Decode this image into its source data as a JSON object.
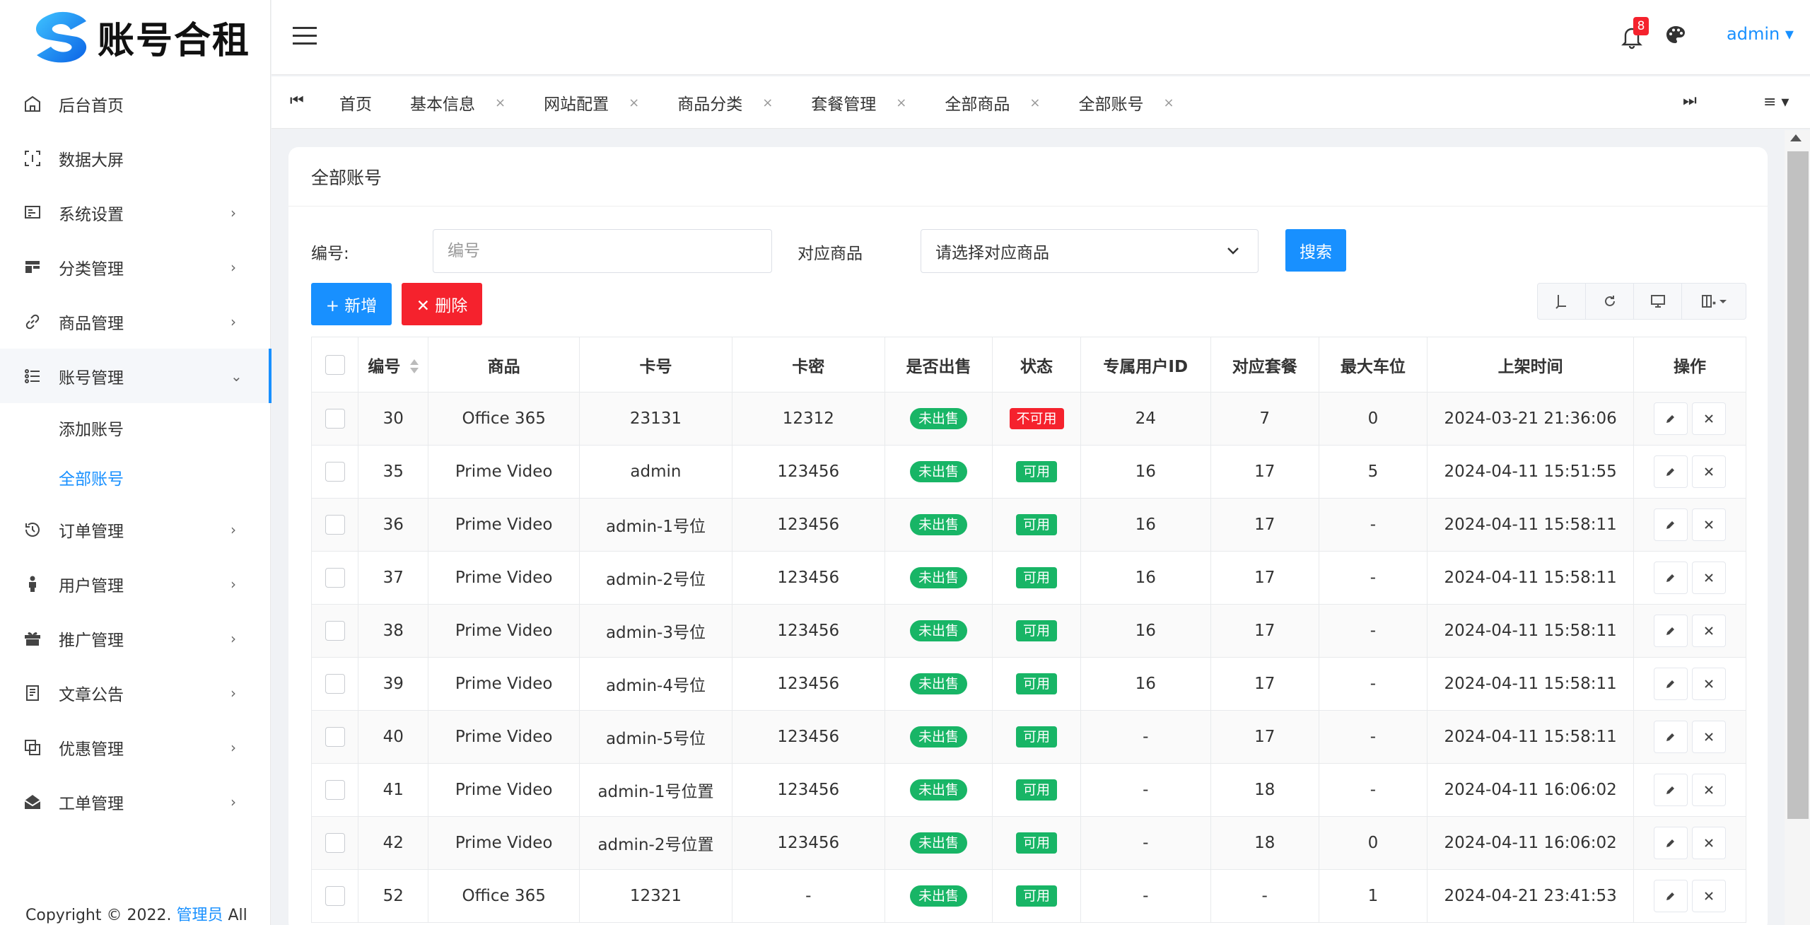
{
  "brand": {
    "name": "账号合租"
  },
  "sidebar": {
    "items": [
      {
        "label": "后台首页",
        "icon": "home-icon",
        "arrow": ""
      },
      {
        "label": "数据大屏",
        "icon": "screen-icon",
        "arrow": ""
      },
      {
        "label": "系统设置",
        "icon": "settings-icon",
        "arrow": "›"
      },
      {
        "label": "分类管理",
        "icon": "category-icon",
        "arrow": "›"
      },
      {
        "label": "商品管理",
        "icon": "link-icon",
        "arrow": "›"
      },
      {
        "label": "账号管理",
        "icon": "list-icon",
        "arrow": "⌄"
      }
    ],
    "subitems": [
      {
        "label": "添加账号"
      },
      {
        "label": "全部账号"
      }
    ],
    "items_after": [
      {
        "label": "订单管理",
        "icon": "history-icon",
        "arrow": "›"
      },
      {
        "label": "用户管理",
        "icon": "user-icon",
        "arrow": "›"
      },
      {
        "label": "推广管理",
        "icon": "gift-icon",
        "arrow": "›"
      },
      {
        "label": "文章公告",
        "icon": "article-icon",
        "arrow": "›"
      },
      {
        "label": "优惠管理",
        "icon": "coupon-icon",
        "arrow": "›"
      },
      {
        "label": "工单管理",
        "icon": "mail-icon",
        "arrow": "›"
      }
    ],
    "copyright_prefix": "Copyright © 2022.",
    "copyright_link": "管理员",
    "copyright_suffix": "All"
  },
  "header": {
    "notification_count": "8",
    "user": "admin ▾"
  },
  "tabs": {
    "first_btn": "⏮",
    "last_btn": "⏭",
    "menu_btn": "≡ ▾",
    "items": [
      {
        "label": "首页",
        "close": ""
      },
      {
        "label": "基本信息",
        "close": "×"
      },
      {
        "label": "网站配置",
        "close": "×"
      },
      {
        "label": "商品分类",
        "close": "×"
      },
      {
        "label": "套餐管理",
        "close": "×"
      },
      {
        "label": "全部商品",
        "close": "×"
      },
      {
        "label": "全部账号",
        "close": "×"
      }
    ]
  },
  "page": {
    "title": "全部账号",
    "search": {
      "id_label": "编号:",
      "id_placeholder": "编号",
      "product_label": "对应商品",
      "product_placeholder": "请选择对应商品",
      "search_btn": "搜索"
    },
    "actions": {
      "add_btn": "+ 新增",
      "delete_btn": "✕ 删除"
    }
  },
  "table": {
    "columns": [
      "编号",
      "商品",
      "卡号",
      "卡密",
      "是否出售",
      "状态",
      "专属用户ID",
      "对应套餐",
      "最大车位",
      "上架时间",
      "操作"
    ],
    "rows": [
      {
        "id": "30",
        "product": "Office 365",
        "card": "23131",
        "secret": "12312",
        "sold": "未出售",
        "status": "不可用",
        "status_color": "#f5222d",
        "uid": "24",
        "plan": "7",
        "seats": "0",
        "time": "2024-03-21 21:36:06"
      },
      {
        "id": "35",
        "product": "Prime Video",
        "card": "admin",
        "secret": "123456",
        "sold": "未出售",
        "status": "可用",
        "status_color": "#18b566",
        "uid": "16",
        "plan": "17",
        "seats": "5",
        "time": "2024-04-11 15:51:55"
      },
      {
        "id": "36",
        "product": "Prime Video",
        "card": "admin-1号位",
        "secret": "123456",
        "sold": "未出售",
        "status": "可用",
        "status_color": "#18b566",
        "uid": "16",
        "plan": "17",
        "seats": "-",
        "time": "2024-04-11 15:58:11"
      },
      {
        "id": "37",
        "product": "Prime Video",
        "card": "admin-2号位",
        "secret": "123456",
        "sold": "未出售",
        "status": "可用",
        "status_color": "#18b566",
        "uid": "16",
        "plan": "17",
        "seats": "-",
        "time": "2024-04-11 15:58:11"
      },
      {
        "id": "38",
        "product": "Prime Video",
        "card": "admin-3号位",
        "secret": "123456",
        "sold": "未出售",
        "status": "可用",
        "status_color": "#18b566",
        "uid": "16",
        "plan": "17",
        "seats": "-",
        "time": "2024-04-11 15:58:11"
      },
      {
        "id": "39",
        "product": "Prime Video",
        "card": "admin-4号位",
        "secret": "123456",
        "sold": "未出售",
        "status": "可用",
        "status_color": "#18b566",
        "uid": "16",
        "plan": "17",
        "seats": "-",
        "time": "2024-04-11 15:58:11"
      },
      {
        "id": "40",
        "product": "Prime Video",
        "card": "admin-5号位",
        "secret": "123456",
        "sold": "未出售",
        "status": "可用",
        "status_color": "#18b566",
        "uid": "-",
        "plan": "17",
        "seats": "-",
        "time": "2024-04-11 15:58:11"
      },
      {
        "id": "41",
        "product": "Prime Video",
        "card": "admin-1号位置",
        "secret": "123456",
        "sold": "未出售",
        "status": "可用",
        "status_color": "#18b566",
        "uid": "-",
        "plan": "18",
        "seats": "-",
        "time": "2024-04-11 16:06:02"
      },
      {
        "id": "42",
        "product": "Prime Video",
        "card": "admin-2号位置",
        "secret": "123456",
        "sold": "未出售",
        "status": "可用",
        "status_color": "#18b566",
        "uid": "-",
        "plan": "18",
        "seats": "0",
        "time": "2024-04-11 16:06:02"
      },
      {
        "id": "52",
        "product": "Office 365",
        "card": "12321",
        "secret": "-",
        "sold": "未出售",
        "status": "可用",
        "status_color": "#18b566",
        "uid": "-",
        "plan": "-",
        "seats": "1",
        "time": "2024-04-21 23:41:53"
      }
    ]
  },
  "colors": {
    "accent": "#1890ff",
    "danger": "#f5222d",
    "success": "#18b566"
  }
}
